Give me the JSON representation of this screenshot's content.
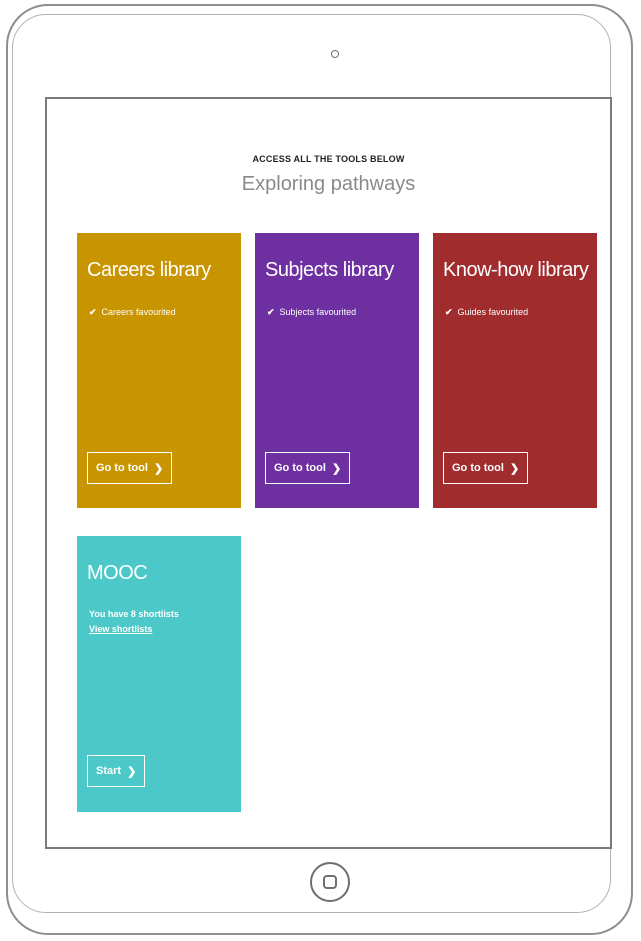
{
  "header": {
    "eyebrow": "ACCESS ALL THE TOOLS BELOW",
    "title": "Exploring pathways"
  },
  "cards": [
    {
      "title": "Careers library",
      "check": "Careers favourited",
      "button": "Go to tool",
      "color": "#c89400"
    },
    {
      "title": "Subjects library",
      "check": "Subjects favourited",
      "button": "Go to tool",
      "color": "#6e2fa0"
    },
    {
      "title": "Know-how library",
      "check": "Guides favourited",
      "button": "Go to tool",
      "color": "#a02c2e"
    },
    {
      "title": "MOOC",
      "text": "You have 8 shortlists",
      "link": "View shortlists",
      "button": "Start",
      "color": "#4cc8c8"
    }
  ],
  "icons": {
    "check": "✔",
    "chevron": "❯"
  }
}
